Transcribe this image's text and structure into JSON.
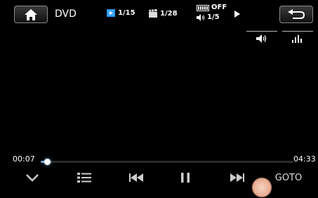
{
  "header": {
    "source_label": "DVD",
    "home_icon": "home-icon",
    "back_icon": "back-arrow-icon",
    "chapter": "1/15",
    "title": "1/28",
    "repeat": "OFF",
    "audio_track": "1/5"
  },
  "tabs": {
    "volume_icon": "speaker-icon",
    "eq_icon": "equalizer-icon"
  },
  "playback": {
    "current_time": "00:07",
    "total_time": "04:33",
    "progress_fraction": 0.026
  },
  "controls": {
    "goto_label": "GOTO"
  },
  "colors": {
    "accent_blue": "#1e90ff",
    "progress_fill": "#6fa8d8"
  }
}
